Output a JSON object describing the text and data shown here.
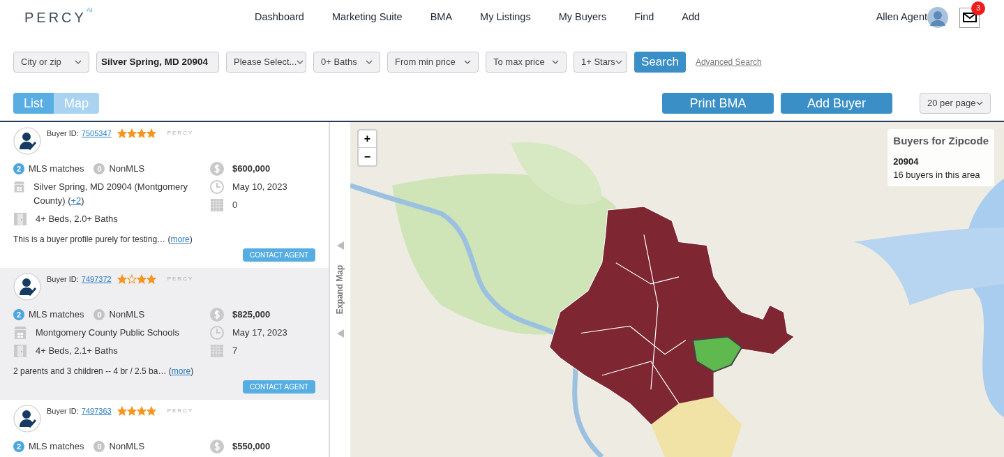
{
  "header": {
    "logo": "PERCY",
    "logo_mark": "AI",
    "nav": [
      {
        "label": "Dashboard"
      },
      {
        "label": "Marketing Suite"
      },
      {
        "label": "BMA"
      },
      {
        "label": "My Listings"
      },
      {
        "label": "My Buyers"
      },
      {
        "label": "Find"
      },
      {
        "label": "Add"
      }
    ],
    "user": "Allen Agent",
    "mail_count": "3"
  },
  "filters": {
    "location_type": "City or zip",
    "location": "Silver Spring, MD 20904",
    "select": "Please Select...",
    "baths": "0+ Baths",
    "min_price": "From min price",
    "max_price": "To max price",
    "stars": "1+ Stars",
    "search": "Search",
    "advanced": "Advanced Search"
  },
  "view_tabs": [
    {
      "label": "List",
      "selected": true
    },
    {
      "label": "Map",
      "selected": false
    }
  ],
  "actions": {
    "print": "Print BMA",
    "add": "Add Buyer",
    "per_page": "20 per page"
  },
  "buyers": [
    {
      "id_label": "Buyer ID:",
      "id": "7505347",
      "stars": [
        true,
        true,
        true,
        true
      ],
      "brand": "PERCY",
      "mls_count": "2",
      "mls_label": "MLS matches",
      "nonmls_count": "0",
      "nonmls_label": "NonMLS",
      "price": "$600,000",
      "location": "Silver Spring, MD 20904 (Montgomery County)",
      "more_locations": "+2",
      "paren_open": "(",
      "paren_close": ")",
      "date": "May 10, 2023",
      "beds": "4+ Beds, 2.0+ Baths",
      "count": "0",
      "note": "This is a buyer profile purely for testing… (",
      "more": "more",
      "note_close": ")",
      "contact": "CONTACT AGENT",
      "shaded": false
    },
    {
      "id_label": "Buyer ID:",
      "id": "7497372",
      "stars": [
        true,
        false,
        true,
        true
      ],
      "brand": "PERCY",
      "mls_count": "2",
      "mls_label": "MLS matches",
      "nonmls_count": "0",
      "nonmls_label": "NonMLS",
      "price": "$825,000",
      "location": "Montgomery County Public Schools",
      "date": "May 17, 2023",
      "beds": "4+ Beds, 2.1+ Baths",
      "count": "7",
      "note": "2 parents and 3 children -- 4 br / 2.5 ba… (",
      "more": "more",
      "note_close": ")",
      "contact": "CONTACT AGENT",
      "shaded": true
    },
    {
      "id_label": "Buyer ID:",
      "id": "7497363",
      "stars": [
        true,
        true,
        true,
        true
      ],
      "brand": "PERCY",
      "mls_count": "2",
      "mls_label": "MLS matches",
      "nonmls_count": "0",
      "nonmls_label": "NonMLS",
      "price": "$550,000",
      "shaded": false
    }
  ],
  "map": {
    "expand": "Expand Map",
    "zoom_in": "+",
    "zoom_out": "−",
    "info": {
      "title": "Buyers for Zipcode",
      "zip": "20904",
      "buyers": "16 buyers in this area"
    }
  }
}
